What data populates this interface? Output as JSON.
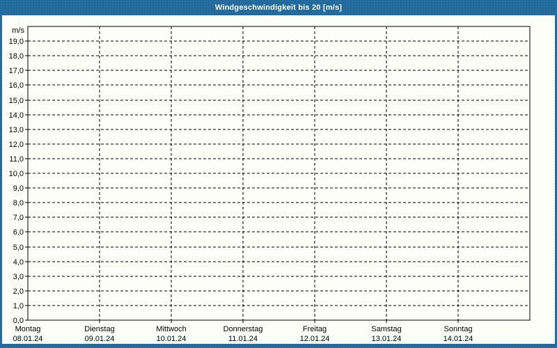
{
  "title_bar": {
    "title": "Windgeschwindigkeit bis 20 [m/s]"
  },
  "colors": {
    "frame": "#1f699c",
    "frame_dot": "#2e76a8",
    "content_bg": "#fdfef7",
    "axis": "#000000",
    "grid": "#000000",
    "text": "#000000",
    "title_text": "#ffffff"
  },
  "chart_data": {
    "type": "line",
    "title": "Windgeschwindigkeit bis 20 [m/s]",
    "ylabel": "m/s",
    "ylim": [
      0,
      20
    ],
    "ytick_step": 1,
    "ytick_labels": [
      "19,0",
      "18,0",
      "17,0",
      "16,0",
      "15,0",
      "14,0",
      "13,0",
      "12,0",
      "11,0",
      "10,0",
      "9,0",
      "8,0",
      "7,0",
      "6,0",
      "5,0",
      "4,0",
      "3,0",
      "2,0",
      "1,0",
      "0,0"
    ],
    "categories": [
      {
        "weekday": "Montag",
        "date": "08.01.24"
      },
      {
        "weekday": "Dienstag",
        "date": "09.01.24"
      },
      {
        "weekday": "Mittwoch",
        "date": "10.01.24"
      },
      {
        "weekday": "Donnerstag",
        "date": "11.01.24"
      },
      {
        "weekday": "Freitag",
        "date": "12.01.24"
      },
      {
        "weekday": "Samstag",
        "date": "13.01.24"
      },
      {
        "weekday": "Sonntag",
        "date": "14.01.24"
      }
    ],
    "series": [],
    "grid": "dashed",
    "legend": "none"
  }
}
